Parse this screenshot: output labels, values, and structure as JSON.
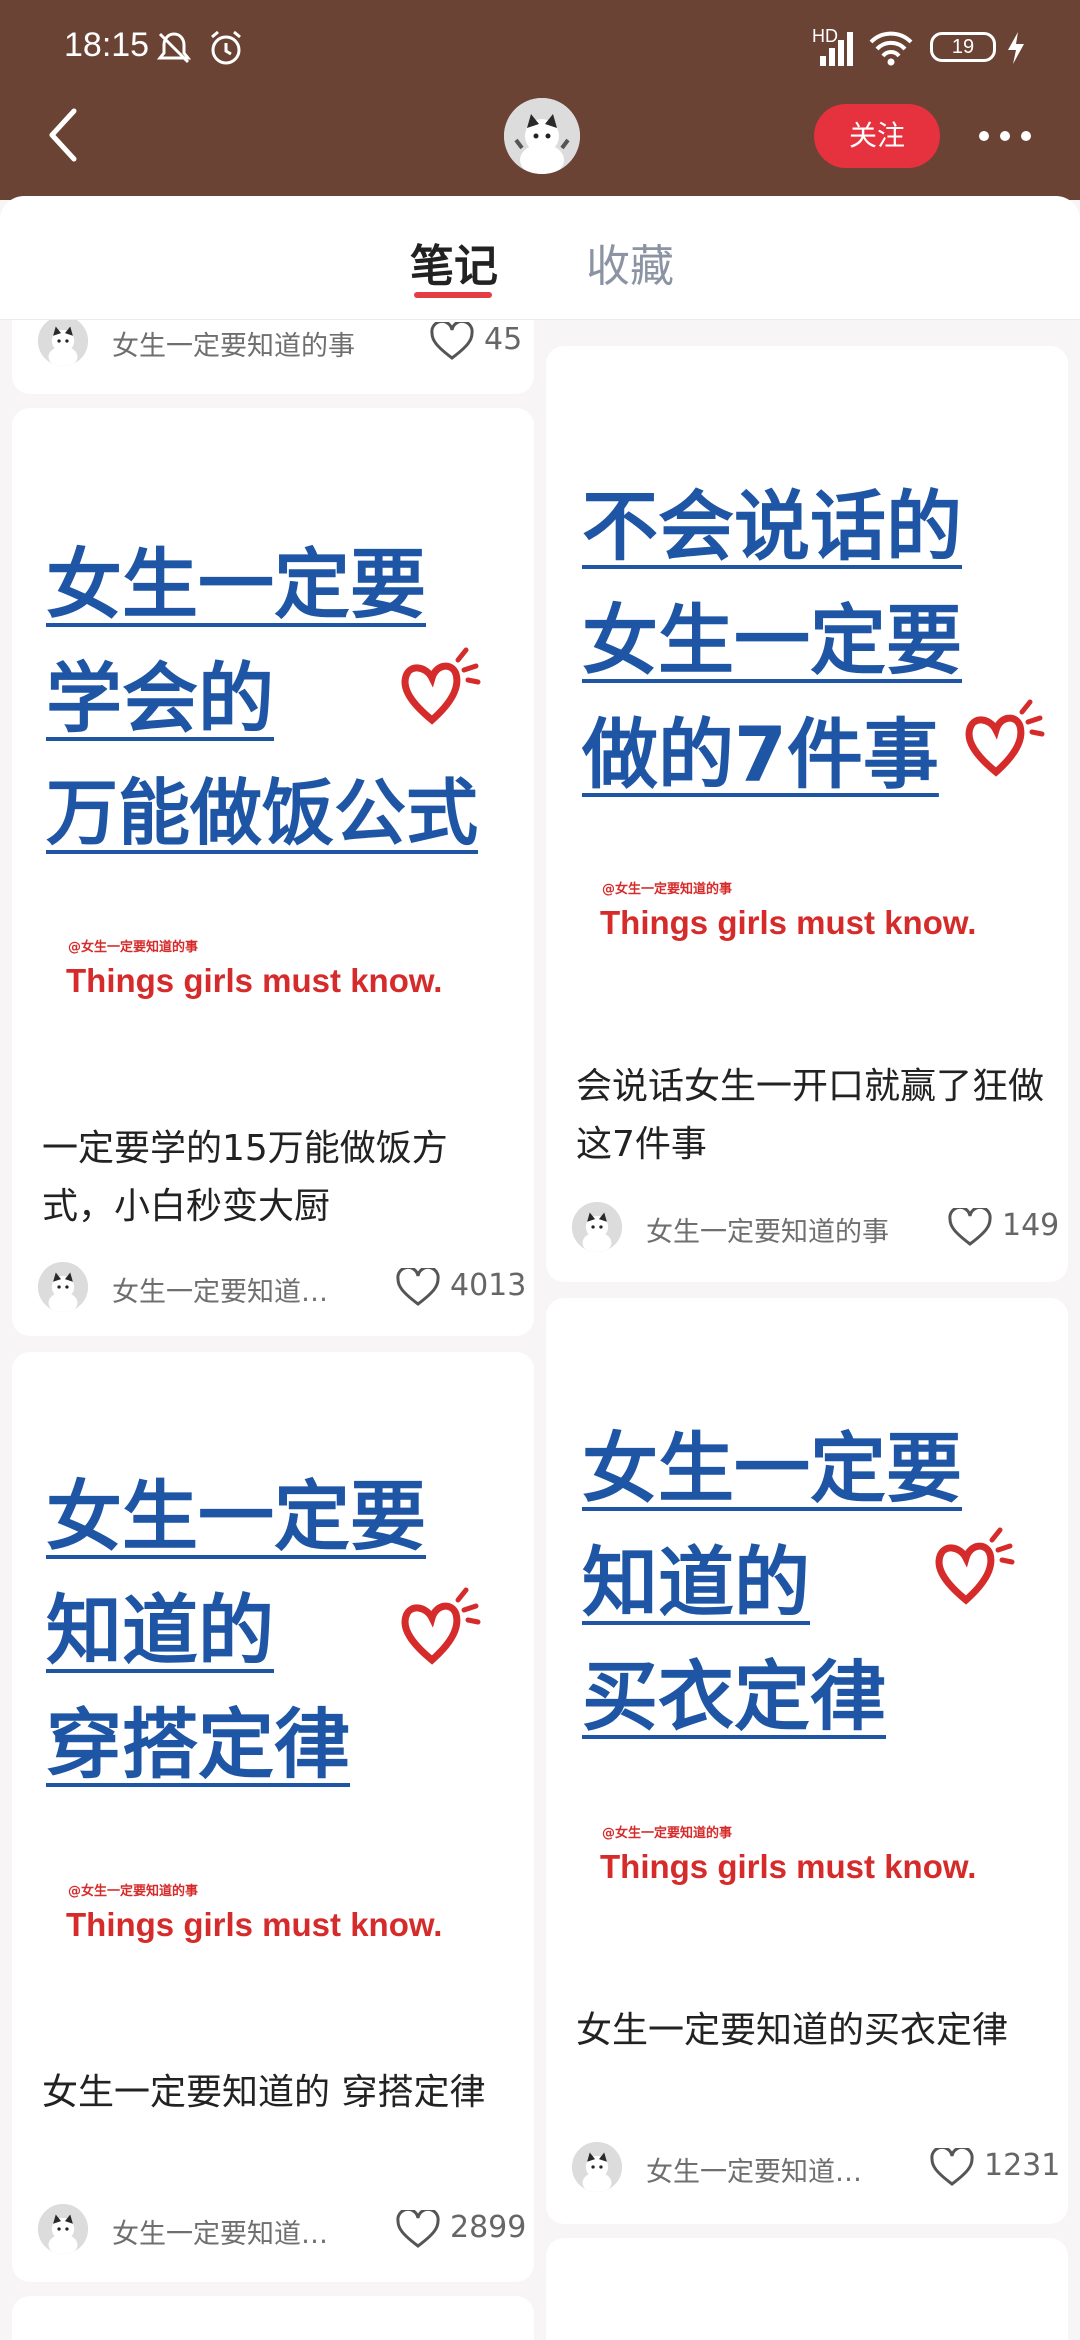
{
  "status": {
    "time": "18:15",
    "network": "HD",
    "battery": "19"
  },
  "header": {
    "follow_label": "关注"
  },
  "tabs": [
    {
      "label": "笔记"
    },
    {
      "label": "收藏"
    }
  ],
  "top_partial": {
    "author": "女生一定要知道的事",
    "likes": "45"
  },
  "cards": [
    {
      "cover_lines": [
        "女生一定要",
        "学会的",
        "万能做饭公式"
      ],
      "brand_small": "@女生一定要知道的事",
      "brand_big": "Things girls must know.",
      "description": "一定要学的15万能做饭方式，小白秒变大厨",
      "author": "女生一定要知道…",
      "likes": "4013"
    },
    {
      "cover_lines": [
        "不会说话的",
        "女生一定要",
        "做的7件事"
      ],
      "brand_small": "@女生一定要知道的事",
      "brand_big": "Things girls must know.",
      "description": "会说话女生一开口就赢了狂做这7件事",
      "author": "女生一定要知道的事",
      "likes": "149"
    },
    {
      "cover_lines": [
        "女生一定要",
        "知道的",
        "穿搭定律"
      ],
      "brand_small": "@女生一定要知道的事",
      "brand_big": "Things girls must know.",
      "description": "女生一定要知道的 穿搭定律",
      "author": "女生一定要知道…",
      "likes": "2899"
    },
    {
      "cover_lines": [
        "女生一定要",
        "知道的",
        "买衣定律"
      ],
      "brand_small": "@女生一定要知道的事",
      "brand_big": "Things girls must know.",
      "description": "女生一定要知道的买衣定律",
      "author": "女生一定要知道…",
      "likes": "1231"
    }
  ],
  "colors": {
    "header_bg": "#6b4334",
    "follow_bg": "#e6313f",
    "cover_text": "#1e55a4",
    "brand_red": "#d62b2b"
  }
}
